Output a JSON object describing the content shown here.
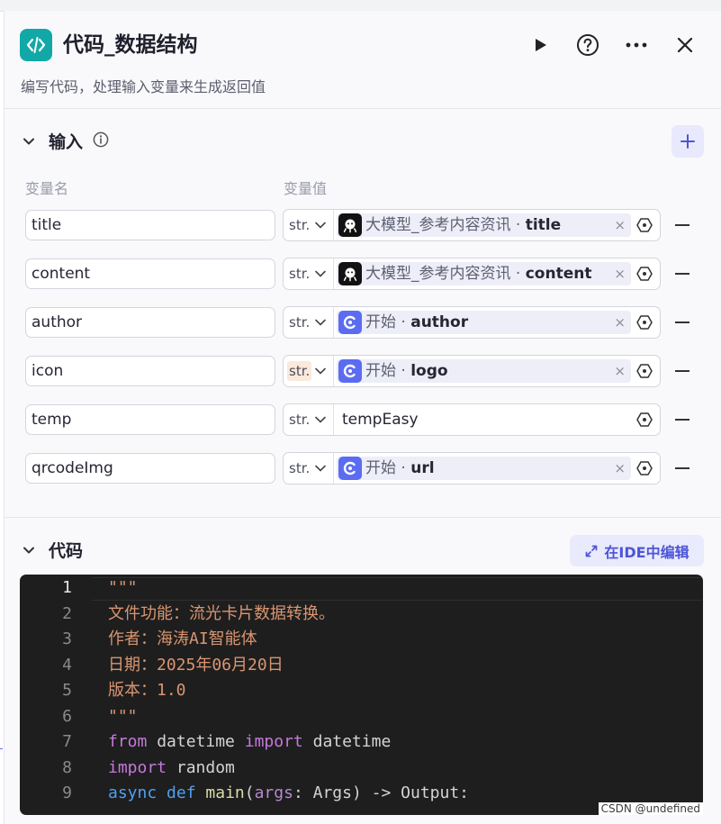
{
  "header": {
    "title": "代码_数据结构",
    "description": "编写代码，处理输入变量来生成返回值",
    "icon": "code-brackets-icon"
  },
  "input_section": {
    "title": "输入",
    "col_name": "变量名",
    "col_value": "变量值",
    "rows": [
      {
        "name": "title",
        "type": "str.",
        "source": "大模型_参考内容资讯",
        "field": "title",
        "icon": "robot-icon"
      },
      {
        "name": "content",
        "type": "str.",
        "source": "大模型_参考内容资讯",
        "field": "content",
        "icon": "robot-icon"
      },
      {
        "name": "author",
        "type": "str.",
        "source": "开始",
        "field": "author",
        "icon": "start-icon"
      },
      {
        "name": "icon",
        "type": "str.",
        "source": "开始",
        "field": "logo",
        "icon": "start-icon"
      },
      {
        "name": "temp",
        "type": "str.",
        "value": "tempEasy"
      },
      {
        "name": "qrcodeImg",
        "type": "str.",
        "source": "开始",
        "field": "url",
        "icon": "start-icon"
      }
    ]
  },
  "code_section": {
    "title": "代码",
    "ide_button": "在IDE中编辑",
    "line_numbers": [
      "1",
      "2",
      "3",
      "4",
      "5",
      "6",
      "7",
      "8",
      "9"
    ],
    "lines": [
      "\"\"\"",
      "文件功能：流光卡片数据转换。",
      "作者：海涛AI智能体",
      "日期：2025年06月20日",
      "版本：1.0",
      "\"\"\"",
      "from datetime import datetime",
      "import random",
      "async def main(args: Args) -> Output:"
    ]
  },
  "watermark": "CSDN @undefined",
  "colors": {
    "accent": "#5b6cf3",
    "header_icon": "#13a8a8",
    "editor_bg": "#1e1e1e"
  }
}
